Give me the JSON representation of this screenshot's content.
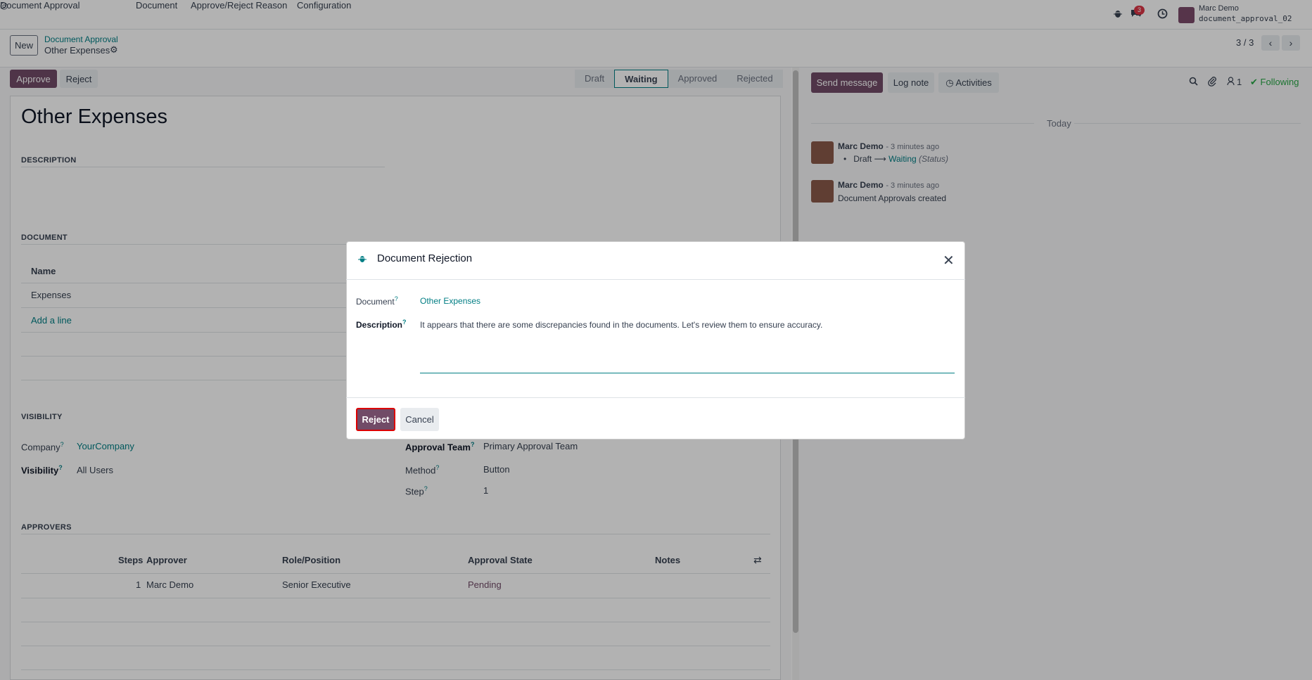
{
  "nav": {
    "brand": "Document Approval",
    "menu": [
      "Document",
      "Approve/Reject Reason",
      "Configuration"
    ],
    "chat_badge": "3",
    "user_name": "Marc Demo",
    "user_db": "document_approval_02"
  },
  "control_panel": {
    "new_label": "New",
    "breadcrumb_parent": "Document Approval",
    "breadcrumb_current": "Other Expenses",
    "pager": "3 / 3"
  },
  "form": {
    "approve_label": "Approve",
    "reject_label": "Reject",
    "stages": [
      "Draft",
      "Waiting",
      "Approved",
      "Rejected"
    ],
    "active_stage": "Waiting",
    "title": "Other Expenses",
    "description_heading": "DESCRIPTION",
    "document_heading": "DOCUMENT",
    "document_table": {
      "header": "Name",
      "rows": [
        "Expenses"
      ],
      "add_line": "Add a line"
    },
    "visibility_heading": "VISIBILITY",
    "company_label": "Company",
    "company_value": "YourCompany",
    "visibility_label": "Visibility",
    "visibility_value": "All Users",
    "approval_team_label": "Approval Team",
    "approval_team_value": "Primary Approval Team",
    "method_label": "Method",
    "method_value": "Button",
    "step_label": "Step",
    "step_value": "1",
    "approvers_heading": "APPROVERS",
    "approvers_table": {
      "headers": [
        "Steps",
        "Approver",
        "Role/Position",
        "Approval State",
        "Notes"
      ],
      "rows": [
        {
          "steps": "1",
          "approver": "Marc Demo",
          "role": "Senior Executive",
          "state": "Pending"
        }
      ]
    }
  },
  "chatter": {
    "send_message": "Send message",
    "log_note": "Log note",
    "activities": "Activities",
    "followers_count": "1",
    "following": "Following",
    "today": "Today",
    "messages": [
      {
        "author": "Marc Demo",
        "time": "- 3 minutes ago",
        "from": "Draft",
        "to": "Waiting",
        "field": "(Status)"
      },
      {
        "author": "Marc Demo",
        "time": "- 3 minutes ago",
        "body": "Document Approvals created"
      }
    ]
  },
  "modal": {
    "title": "Document Rejection",
    "document_label": "Document",
    "document_value": "Other Expenses",
    "description_label": "Description",
    "description_value": "It appears that there are some discrepancies found in the documents. Let's review them to ensure accuracy.",
    "reject_label": "Reject",
    "cancel_label": "Cancel"
  },
  "colors": {
    "primary": "#714b67",
    "link": "#017e84",
    "success": "#28a745",
    "danger": "#dc3545"
  },
  "icons": [
    "app-icon",
    "bug-icon",
    "chat-icon",
    "clock-icon",
    "gear-icon",
    "chevron-left-icon",
    "chevron-right-icon",
    "search-icon",
    "paperclip-icon",
    "follower-icon",
    "check-icon",
    "close-icon",
    "column-toggle-icon"
  ]
}
